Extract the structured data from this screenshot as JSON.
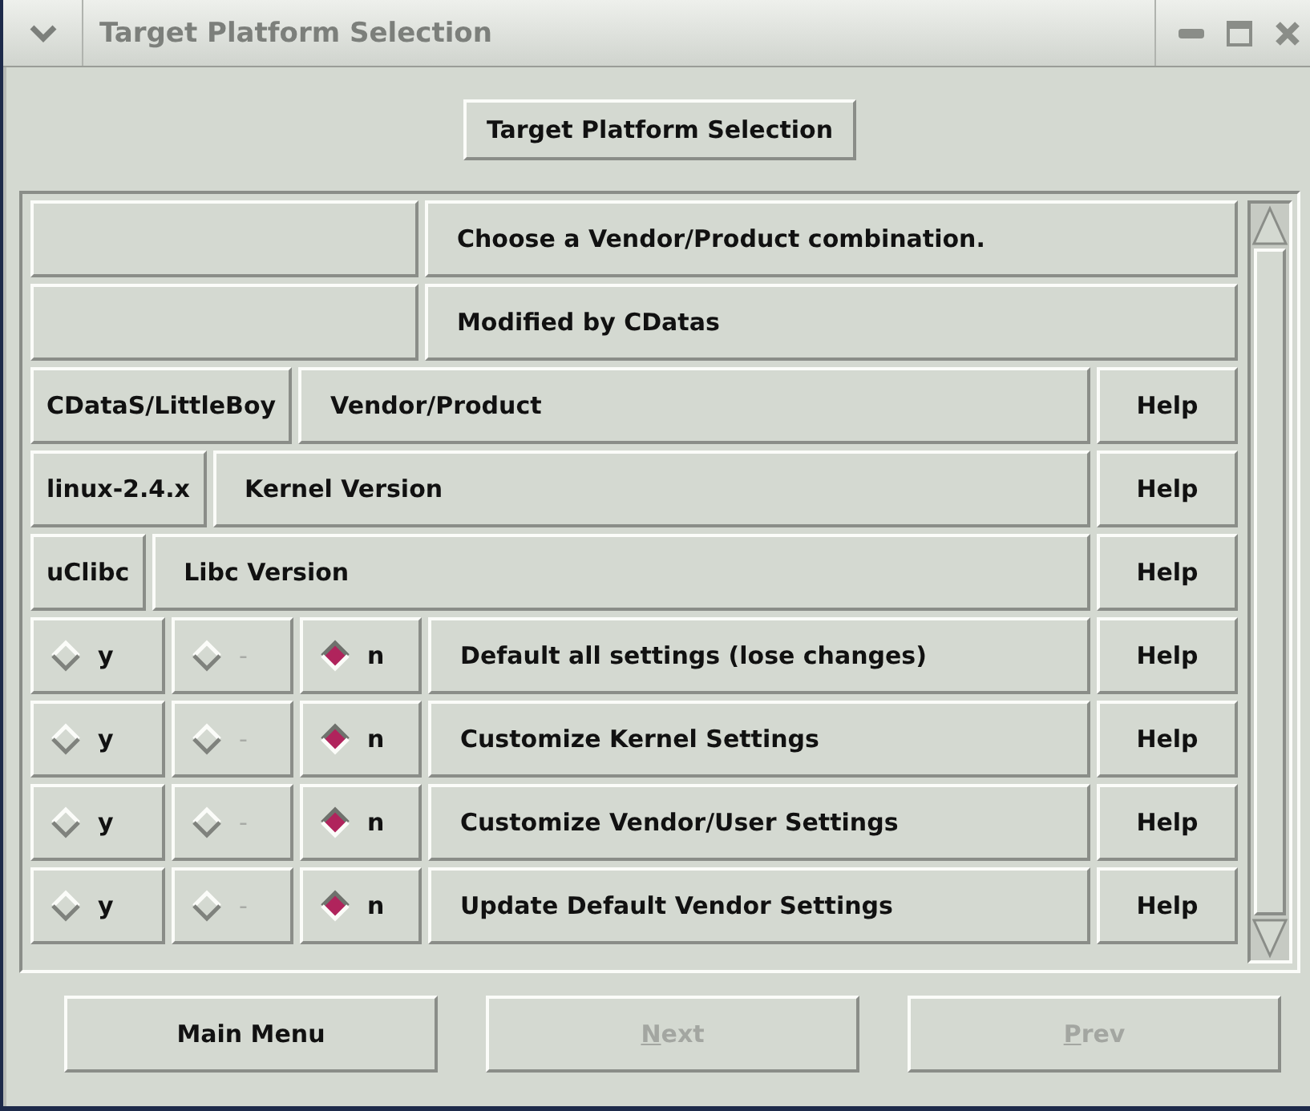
{
  "window": {
    "title": "Target Platform Selection"
  },
  "header_button": "Target Platform Selection",
  "rows": [
    {
      "kind": "info",
      "text": "Choose a Vendor/Product combination."
    },
    {
      "kind": "info",
      "text": "Modified by CDatas"
    },
    {
      "kind": "choice",
      "value": "CDataS/LittleBoy",
      "label": "Vendor/Product",
      "help": "Help"
    },
    {
      "kind": "choice",
      "value": "linux-2.4.x",
      "label": "Kernel Version",
      "help": "Help"
    },
    {
      "kind": "choice",
      "value": "uClibc",
      "label": "Libc Version",
      "help": "Help"
    },
    {
      "kind": "tristate",
      "options": [
        {
          "label": "y",
          "selected": false,
          "disabled": false
        },
        {
          "label": "-",
          "selected": false,
          "disabled": true
        },
        {
          "label": "n",
          "selected": true,
          "disabled": false
        }
      ],
      "label": "Default all settings (lose changes)",
      "help": "Help"
    },
    {
      "kind": "tristate",
      "options": [
        {
          "label": "y",
          "selected": false,
          "disabled": false
        },
        {
          "label": "-",
          "selected": false,
          "disabled": true
        },
        {
          "label": "n",
          "selected": true,
          "disabled": false
        }
      ],
      "label": "Customize Kernel Settings",
      "help": "Help"
    },
    {
      "kind": "tristate",
      "options": [
        {
          "label": "y",
          "selected": false,
          "disabled": false
        },
        {
          "label": "-",
          "selected": false,
          "disabled": true
        },
        {
          "label": "n",
          "selected": true,
          "disabled": false
        }
      ],
      "label": "Customize Vendor/User Settings",
      "help": "Help"
    },
    {
      "kind": "tristate",
      "options": [
        {
          "label": "y",
          "selected": false,
          "disabled": false
        },
        {
          "label": "-",
          "selected": false,
          "disabled": true
        },
        {
          "label": "n",
          "selected": true,
          "disabled": false
        }
      ],
      "label": "Update Default Vendor Settings",
      "help": "Help"
    }
  ],
  "buttons": [
    {
      "label": "Main Menu",
      "disabled": false,
      "mnemonic": false
    },
    {
      "label": "Next",
      "disabled": true,
      "mnemonic": true
    },
    {
      "label": "Prev",
      "disabled": true,
      "mnemonic": true
    }
  ]
}
